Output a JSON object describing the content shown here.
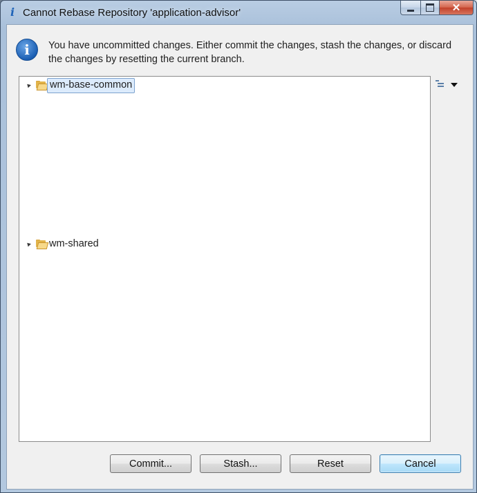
{
  "window": {
    "title": "Cannot Rebase Repository 'application-advisor'",
    "title_icon": "info-icon",
    "controls": {
      "minimize": "minimize-icon",
      "maximize": "maximize-icon",
      "close": "close-icon"
    }
  },
  "dialog": {
    "message": "You have uncommitted changes. Either commit the changes, stash the changes, or discard the changes by resetting the current branch.",
    "icon": "info-icon"
  },
  "tree": {
    "items": [
      {
        "label": "wm-base-common",
        "icon": "folder-open-icon",
        "expanded": true,
        "selected": true
      },
      {
        "label": "wm-shared",
        "icon": "folder-open-icon",
        "expanded": true,
        "selected": false
      }
    ]
  },
  "toolbar": {
    "layout_icon": "tree-layout-icon",
    "menu_icon": "dropdown-arrow-icon"
  },
  "buttons": {
    "commit": "Commit...",
    "stash": "Stash...",
    "reset": "Reset",
    "cancel": "Cancel"
  },
  "colors": {
    "accent": "#3c7fb1",
    "titlebar": "#b9cde3",
    "close": "#c2412a"
  }
}
